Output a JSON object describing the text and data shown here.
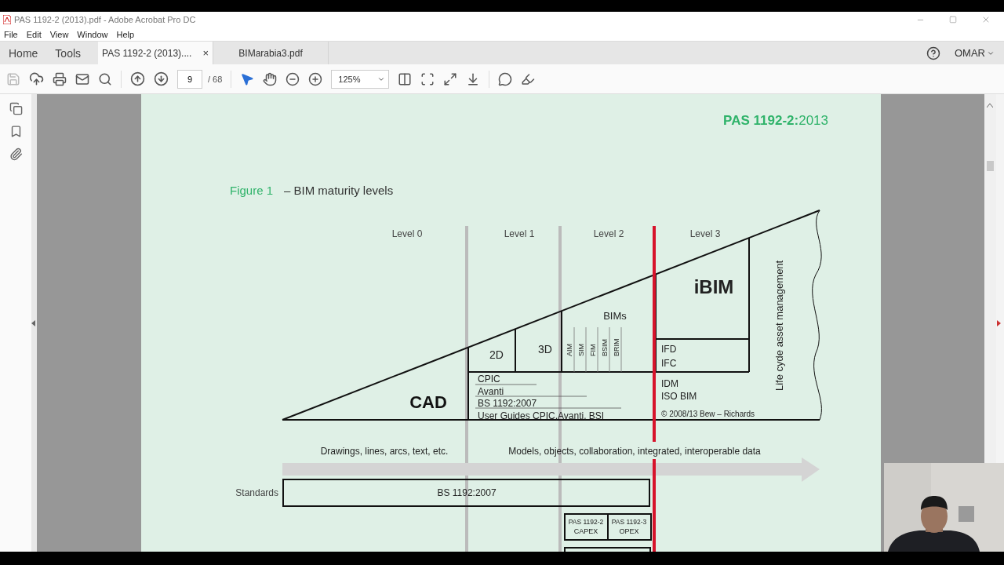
{
  "window": {
    "title": "PAS 1192-2 (2013).pdf - Adobe Acrobat Pro DC"
  },
  "menu": [
    "File",
    "Edit",
    "View",
    "Window",
    "Help"
  ],
  "nav": [
    "Home",
    "Tools"
  ],
  "tabs": [
    {
      "label": "PAS 1192-2 (2013)....",
      "selected": true,
      "closable": true
    },
    {
      "label": "BIMarabia3.pdf",
      "selected": false,
      "closable": false
    }
  ],
  "close_glyph": "×",
  "account": {
    "name": "OMAR"
  },
  "toolbar": {
    "page": "9",
    "page_count": "/ 68",
    "zoom": "125%"
  },
  "document": {
    "header": "**PAS 1192-2:**2013",
    "figure_label": "Figure 1",
    "figure_title": "– BIM maturity levels",
    "levels": [
      "Level 0",
      "Level 1",
      "Level 2",
      "Level 3"
    ],
    "cad": "CAD",
    "d2": "2D",
    "d3": "3D",
    "bims": "BIMs",
    "bim_types": [
      "AIM",
      "SIM",
      "FIM",
      "BSIM",
      "BRIM"
    ],
    "ibim": "iBIM",
    "level1_items": [
      "CPIC",
      "Avanti",
      "BS 1192:2007",
      "User Guides CPIC,Avanti, BSI"
    ],
    "level3_items": [
      "IFD",
      "IFC"
    ],
    "level3_standards": [
      "IDM",
      "ISO BIM"
    ],
    "copyright": "© 2008/13 Bew – Richards",
    "lifecycle": "Life cyde asset management",
    "arrow_labels": [
      "Drawings, lines, arcs, text, etc.",
      "Models, objects, collaboration, integrated, interoperable data"
    ],
    "standards_label": "Standards",
    "standard": "BS 1192:2007",
    "pas": [
      {
        "code": "PAS 1192-2",
        "phase": "CAPEX"
      },
      {
        "code": "PAS 1192-3",
        "phase": "OPEX"
      }
    ]
  }
}
